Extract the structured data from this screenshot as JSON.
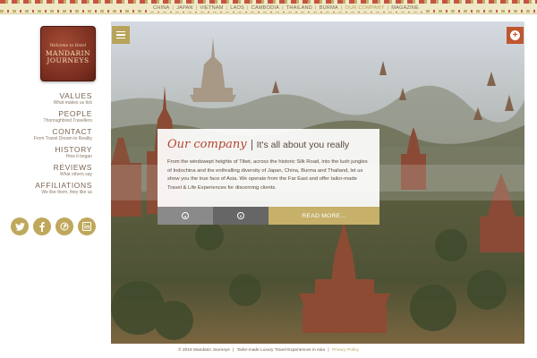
{
  "top_nav": {
    "items": [
      {
        "label": "CHINA"
      },
      {
        "label": "JAPAN"
      },
      {
        "label": "VIETNAM"
      },
      {
        "label": "LAOS"
      },
      {
        "label": "CAMBODIA"
      },
      {
        "label": "THAILAND"
      },
      {
        "label": "BURMA"
      },
      {
        "label": "OUR COMPANY",
        "active": true
      },
      {
        "label": "MAGAZINE"
      }
    ],
    "separator": "|"
  },
  "logo": {
    "tagline": "Welcome to Hotel",
    "name_line1": "MANDARIN",
    "name_line2": "JOURNEYS"
  },
  "side_nav": {
    "items": [
      {
        "title": "VALUES",
        "subtitle": "What makes us tick"
      },
      {
        "title": "PEOPLE",
        "subtitle": "Thoroughbred Travellers"
      },
      {
        "title": "CONTACT",
        "subtitle": "From Travel Dream to Reality"
      },
      {
        "title": "HISTORY",
        "subtitle": "How it began"
      },
      {
        "title": "REVIEWS",
        "subtitle": "What others say"
      },
      {
        "title": "AFFILIATIONS",
        "subtitle": "We like them, they like us"
      }
    ]
  },
  "social": {
    "icons": [
      {
        "name": "twitter-icon",
        "glyph": "🐦"
      },
      {
        "name": "facebook-icon",
        "glyph": "f"
      },
      {
        "name": "pinterest-icon",
        "glyph": "℗"
      },
      {
        "name": "linkedin-icon",
        "glyph": "in"
      }
    ]
  },
  "card": {
    "title": "Our company",
    "subtitle": "It's all about you really",
    "body": "From the windswept heights of Tibet, across the historic Silk Road, into the lush jungles of Indochina and the enthralling diversity of Japan, China, Burma and Thailand, let us show you the true face of Asia. We operate from the Far East and offer tailor-made Travel & Life Experiences for discerning clients.",
    "read_more": "READ MORE..."
  },
  "footer": {
    "copyright": "© 2016 Mandarin Journeys",
    "separator": "|",
    "tagline": "Tailor-made Luxury Travel Experiences in Asia",
    "privacy": "Privacy Policy"
  },
  "colors": {
    "accent_gold": "#b8a35a",
    "accent_red": "#c0562f",
    "title_red": "#b5452f",
    "text_brown": "#6b5a48"
  }
}
